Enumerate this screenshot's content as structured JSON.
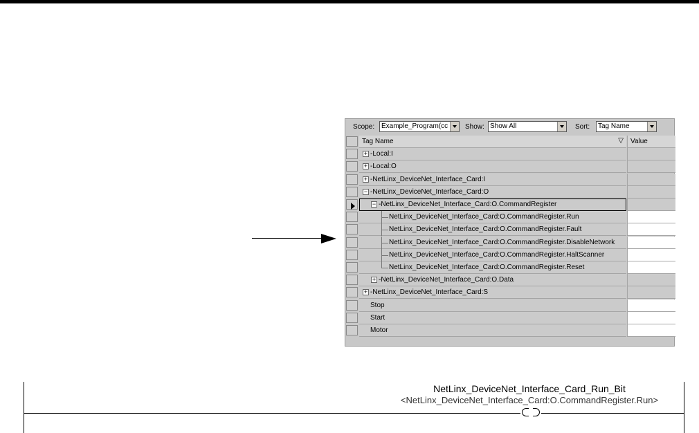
{
  "toolbar": {
    "scope_label": "Scope:",
    "scope_value": "Example_Program(cc",
    "show_label": "Show:",
    "show_value": "Show All",
    "sort_label": "Sort:",
    "sort_value": "Tag Name"
  },
  "grid": {
    "columns": {
      "name": "Tag Name",
      "value": "Value"
    },
    "rows": [
      {
        "name": "Local:I",
        "level": 0,
        "expander": "+",
        "value_white": false
      },
      {
        "name": "Local:O",
        "level": 0,
        "expander": "+",
        "value_white": false
      },
      {
        "name": "NetLinx_DeviceNet_Interface_Card:I",
        "level": 0,
        "expander": "+",
        "value_white": false
      },
      {
        "name": "NetLinx_DeviceNet_Interface_Card:O",
        "level": 0,
        "expander": "-",
        "value_white": false
      },
      {
        "name": "NetLinx_DeviceNet_Interface_Card:O.CommandRegister",
        "level": 1,
        "expander": "-",
        "value_white": false,
        "selected": true
      },
      {
        "name": "NetLinx_DeviceNet_Interface_Card:O.CommandRegister.Run",
        "level": 2,
        "expander": "",
        "value_white": true
      },
      {
        "name": "NetLinx_DeviceNet_Interface_Card:O.CommandRegister.Fault",
        "level": 2,
        "expander": "",
        "value_white": true
      },
      {
        "name": "NetLinx_DeviceNet_Interface_Card:O.CommandRegister.DisableNetwork",
        "level": 2,
        "expander": "",
        "value_white": true
      },
      {
        "name": "NetLinx_DeviceNet_Interface_Card:O.CommandRegister.HaltScanner",
        "level": 2,
        "expander": "",
        "value_white": true
      },
      {
        "name": "NetLinx_DeviceNet_Interface_Card:O.CommandRegister.Reset",
        "level": 2,
        "expander": "",
        "value_white": true
      },
      {
        "name": "NetLinx_DeviceNet_Interface_Card:O.Data",
        "level": 1,
        "expander": "+",
        "value_white": false
      },
      {
        "name": "NetLinx_DeviceNet_Interface_Card:S",
        "level": 0,
        "expander": "+",
        "value_white": false
      },
      {
        "name": "Stop",
        "level": 0,
        "expander": "",
        "value_white": true
      },
      {
        "name": "Start",
        "level": 0,
        "expander": "",
        "value_white": true
      },
      {
        "name": "Motor",
        "level": 0,
        "expander": "",
        "value_white": true
      }
    ]
  },
  "ladder": {
    "coil_tag": "NetLinx_DeviceNet_Interface_Card_Run_Bit",
    "coil_alias": "<NetLinx_DeviceNet_Interface_Card:O.CommandRegister.Run>"
  },
  "icons": {
    "sort": "sort-down-icon",
    "row_pointer": "current-row-pointer-icon",
    "callout": "arrow-right-icon"
  }
}
